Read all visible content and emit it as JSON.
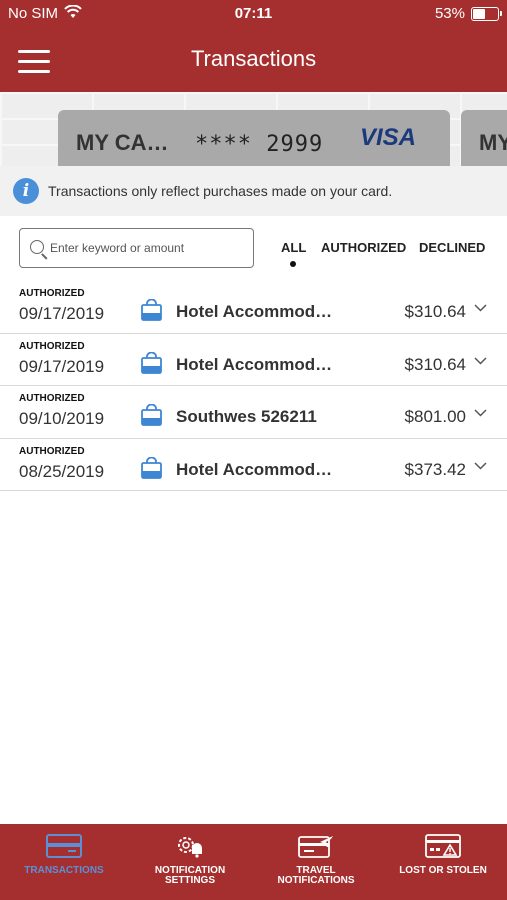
{
  "status_bar": {
    "carrier": "No SIM",
    "time": "07:11",
    "battery_percent": "53%",
    "battery_level": 0.53
  },
  "nav": {
    "title": "Transactions",
    "menu_icon": "hamburger-menu-icon"
  },
  "cards": [
    {
      "name": "MY CA…",
      "number": "**** 2999",
      "brand": "VISA"
    },
    {
      "name": "MY"
    }
  ],
  "info": {
    "icon": "info-icon",
    "text": "Transactions only reflect purchases made on your card."
  },
  "search": {
    "placeholder": "Enter keyword or amount",
    "value": ""
  },
  "filters": {
    "all": "ALL",
    "authorized": "AUTHORIZED",
    "declined": "DECLINED",
    "selected": "ALL"
  },
  "transactions": [
    {
      "status": "AUTHORIZED",
      "date": "09/17/2019",
      "merchant": "Hotel Accommod…",
      "amount": "$310.64"
    },
    {
      "status": "AUTHORIZED",
      "date": "09/17/2019",
      "merchant": "Hotel Accommod…",
      "amount": "$310.64"
    },
    {
      "status": "AUTHORIZED",
      "date": "09/10/2019",
      "merchant": "Southwes 526211",
      "amount": "$801.00"
    },
    {
      "status": "AUTHORIZED",
      "date": "08/25/2019",
      "merchant": "Hotel Accommod…",
      "amount": "$373.42"
    }
  ],
  "tabs": [
    {
      "label": "TRANSACTIONS",
      "icon": "credit-card-icon",
      "active": true
    },
    {
      "label": "NOTIFICATION\nSETTINGS",
      "icon": "gear-bell-icon",
      "active": false
    },
    {
      "label": "TRAVEL\nNOTIFICATIONS",
      "icon": "card-airplane-icon",
      "active": false
    },
    {
      "label": "LOST OR STOLEN",
      "icon": "card-warning-icon",
      "active": false
    }
  ],
  "colors": {
    "brand_red": "#a52f2f",
    "active_tab": "#5c8fd6",
    "info_blue": "#4a90d9",
    "bag_blue": "#3d86d4",
    "visa_blue": "#1a3a7c"
  }
}
